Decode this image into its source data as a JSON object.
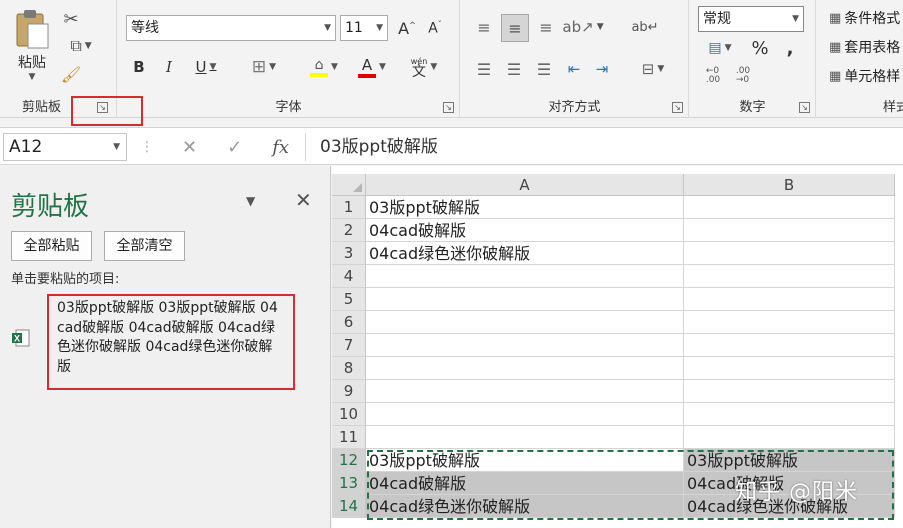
{
  "ribbon": {
    "clipboard": {
      "label": "剪贴板",
      "paste_label": "粘贴"
    },
    "font": {
      "label": "字体",
      "font_name": "等线",
      "font_size": "11",
      "bold": "B",
      "italic": "I",
      "underline": "U",
      "phonetic": "wén"
    },
    "alignment": {
      "label": "对齐方式"
    },
    "number": {
      "label": "数字",
      "format": "常规",
      "percent": "%",
      "comma": ","
    },
    "styles": {
      "label": "样式",
      "conditional": "条件格式",
      "table": "套用表格",
      "cell": "单元格样"
    }
  },
  "formula_bar": {
    "name_box": "A12",
    "fx": "fx",
    "content": "03版ppt破解版"
  },
  "clipboard_pane": {
    "title": "剪贴板",
    "paste_all": "全部粘贴",
    "clear_all": "全部清空",
    "hint": "单击要粘贴的项目:",
    "item_text": "03版ppt破解版 03版ppt破解版 04cad破解版 04cad破解版 04cad绿色迷你破解版 04cad绿色迷你破解版"
  },
  "sheet": {
    "columns": [
      "A",
      "B"
    ],
    "rows": [
      {
        "num": "1",
        "a": "03版ppt破解版",
        "b": ""
      },
      {
        "num": "2",
        "a": "04cad破解版",
        "b": ""
      },
      {
        "num": "3",
        "a": "04cad绿色迷你破解版",
        "b": ""
      },
      {
        "num": "4",
        "a": "",
        "b": ""
      },
      {
        "num": "5",
        "a": "",
        "b": ""
      },
      {
        "num": "6",
        "a": "",
        "b": ""
      },
      {
        "num": "7",
        "a": "",
        "b": ""
      },
      {
        "num": "8",
        "a": "",
        "b": ""
      },
      {
        "num": "9",
        "a": "",
        "b": ""
      },
      {
        "num": "10",
        "a": "",
        "b": ""
      },
      {
        "num": "11",
        "a": "",
        "b": ""
      },
      {
        "num": "12",
        "a": "03版ppt破解版",
        "b": "03版ppt破解版"
      },
      {
        "num": "13",
        "a": "04cad破解版",
        "b": "04cad破解版"
      },
      {
        "num": "14",
        "a": "04cad绿色迷你破解版",
        "b": "04cad绿色迷你破解版"
      }
    ]
  },
  "watermark": "知乎 @阳米",
  "colors": {
    "accent": "#217346",
    "highlight": "#d92b2b"
  }
}
